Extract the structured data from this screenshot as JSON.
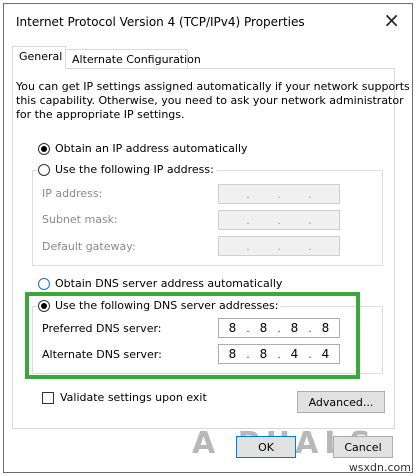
{
  "window": {
    "title": "Internet Protocol Version 4 (TCP/IPv4) Properties",
    "close_glyph": "×"
  },
  "tabs": [
    {
      "label": "General",
      "active": true
    },
    {
      "label": "Alternate Configuration",
      "active": false
    }
  ],
  "description": {
    "line1": "You can get IP settings assigned automatically if your network supports",
    "line2": "this capability. Otherwise, you need to ask your network administrator",
    "line3": "for the appropriate IP settings."
  },
  "ip_section": {
    "obtain_auto_label": "Obtain an IP address automatically",
    "use_following_label": "Use the following IP address:",
    "selected": "obtain_auto",
    "fields": [
      {
        "label": "IP address:",
        "value": [
          "",
          "",
          "",
          ""
        ]
      },
      {
        "label": "Subnet mask:",
        "value": [
          "",
          "",
          "",
          ""
        ]
      },
      {
        "label": "Default gateway:",
        "value": [
          "",
          "",
          "",
          ""
        ]
      }
    ]
  },
  "dns_section": {
    "obtain_auto_label": "Obtain DNS server address automatically",
    "use_following_label": "Use the following DNS server addresses:",
    "selected": "use_following",
    "preferred": {
      "label": "Preferred DNS server:",
      "value": [
        "8",
        "8",
        "8",
        "8"
      ]
    },
    "alternate": {
      "label": "Alternate DNS server:",
      "value": [
        "8",
        "8",
        "4",
        "4"
      ]
    }
  },
  "validate_label": "Validate settings upon exit",
  "validate_checked": false,
  "buttons": {
    "advanced": "Advanced...",
    "ok": "OK",
    "cancel": "Cancel"
  },
  "watermark": {
    "brand": "A  PUALS",
    "site": "wsxdn.com"
  },
  "colors": {
    "highlight": "#3aa83a",
    "accent": "#0078d7"
  }
}
